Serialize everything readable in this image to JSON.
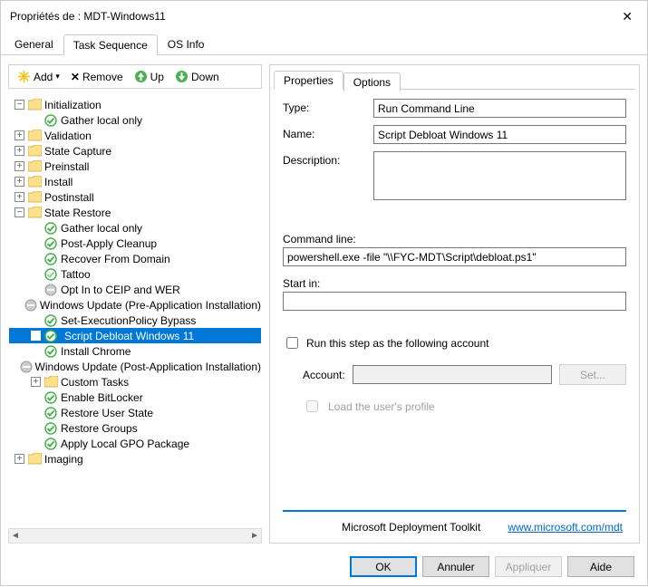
{
  "window": {
    "title": "Propriétés de : MDT-Windows11"
  },
  "tabs": {
    "general": "General",
    "task_sequence": "Task Sequence",
    "os_info": "OS Info"
  },
  "toolbar": {
    "add": "Add",
    "remove": "Remove",
    "up": "Up",
    "down": "Down"
  },
  "tree": [
    {
      "d": 0,
      "e": "-",
      "t": "folder",
      "l": "Initialization"
    },
    {
      "d": 1,
      "e": "",
      "t": "ok",
      "l": "Gather local only"
    },
    {
      "d": 0,
      "e": "+",
      "t": "folder",
      "l": "Validation"
    },
    {
      "d": 0,
      "e": "+",
      "t": "folder",
      "l": "State Capture"
    },
    {
      "d": 0,
      "e": "+",
      "t": "folder",
      "l": "Preinstall"
    },
    {
      "d": 0,
      "e": "+",
      "t": "folder",
      "l": "Install"
    },
    {
      "d": 0,
      "e": "+",
      "t": "folder",
      "l": "Postinstall"
    },
    {
      "d": 0,
      "e": "-",
      "t": "folder",
      "l": "State Restore"
    },
    {
      "d": 1,
      "e": "",
      "t": "ok",
      "l": "Gather local only"
    },
    {
      "d": 1,
      "e": "",
      "t": "ok",
      "l": "Post-Apply Cleanup"
    },
    {
      "d": 1,
      "e": "",
      "t": "ok",
      "l": "Recover From Domain"
    },
    {
      "d": 1,
      "e": "",
      "t": "okt",
      "l": "Tattoo"
    },
    {
      "d": 1,
      "e": "",
      "t": "off",
      "l": "Opt In to CEIP and WER"
    },
    {
      "d": 1,
      "e": "",
      "t": "off",
      "l": "Windows Update (Pre-Application Installation)"
    },
    {
      "d": 1,
      "e": "",
      "t": "ok",
      "l": "Set-ExecutionPolicy Bypass"
    },
    {
      "d": 1,
      "e": "",
      "t": "ok",
      "l": "Script Debloat Windows 11",
      "sel": true
    },
    {
      "d": 1,
      "e": "",
      "t": "ok",
      "l": "Install Chrome"
    },
    {
      "d": 1,
      "e": "",
      "t": "off",
      "l": "Windows Update (Post-Application Installation)"
    },
    {
      "d": 1,
      "e": "+",
      "t": "folder",
      "l": "Custom Tasks"
    },
    {
      "d": 1,
      "e": "",
      "t": "ok",
      "l": "Enable BitLocker"
    },
    {
      "d": 1,
      "e": "",
      "t": "ok",
      "l": "Restore User State"
    },
    {
      "d": 1,
      "e": "",
      "t": "ok",
      "l": "Restore Groups"
    },
    {
      "d": 1,
      "e": "",
      "t": "ok",
      "l": "Apply Local GPO Package"
    },
    {
      "d": 0,
      "e": "+",
      "t": "folder",
      "l": "Imaging"
    }
  ],
  "subtabs": {
    "properties": "Properties",
    "options": "Options"
  },
  "form": {
    "type_label": "Type:",
    "type_value": "Run Command Line",
    "name_label": "Name:",
    "name_value": "Script Debloat Windows 11",
    "desc_label": "Description:",
    "desc_value": "",
    "cmd_label": "Command line:",
    "cmd_value": "powershell.exe -file \"\\\\FYC-MDT\\Script\\debloat.ps1\"",
    "start_label": "Start in:",
    "start_value": "",
    "runas_label": "Run this step as the following account",
    "account_label": "Account:",
    "account_value": "",
    "set_btn": "Set...",
    "load_profile": "Load the user's profile"
  },
  "footer": {
    "brand": "Microsoft Deployment Toolkit",
    "link": "www.microsoft.com/mdt"
  },
  "buttons": {
    "ok": "OK",
    "cancel": "Annuler",
    "apply": "Appliquer",
    "help": "Aide"
  }
}
